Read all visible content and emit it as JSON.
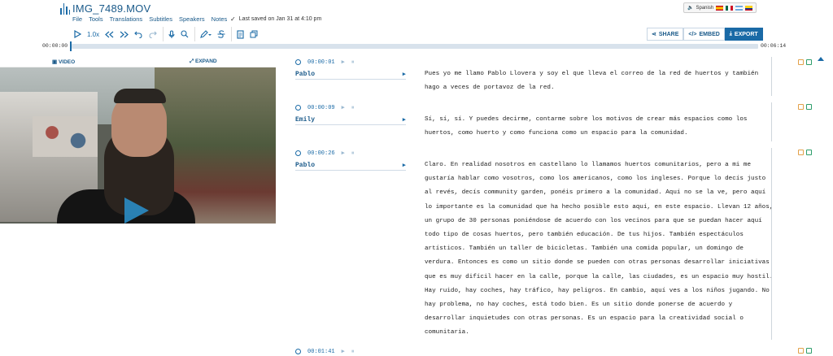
{
  "header": {
    "file_title": "IMG_7489.MOV",
    "menu": [
      "File",
      "Tools",
      "Translations",
      "Subtitles",
      "Speakers",
      "Notes"
    ],
    "saved_status": "Last saved on Jan 31 at 4:10 pm",
    "language_label": "Spanish"
  },
  "toolbar": {
    "speed": "1.0x",
    "share_label": "SHARE",
    "embed_label": "EMBED",
    "export_label": "EXPORT"
  },
  "timeline": {
    "current_time": "00:00:00",
    "total_time": "00:06:14",
    "progress": 0
  },
  "video_panel": {
    "video_label": "VIDEO",
    "expand_label": "EXPAND"
  },
  "transcript": {
    "segments": [
      {
        "timestamp": "00:00:01",
        "speaker": "Pablo",
        "text": "Pues yo me llamo Pablo Llovera y soy el que lleva el correo de la red de huertos y también hago a veces de portavoz de la red."
      },
      {
        "timestamp": "00:00:09",
        "speaker": "Emily",
        "text": "Sí, sí, sí. Y puedes decirme, contarme sobre los motivos de crear más espacios como los huertos, como huerto y como funciona como un espacio para la comunidad."
      },
      {
        "timestamp": "00:00:26",
        "speaker": "Pablo",
        "text": "Claro. En realidad nosotros en castellano lo llamamos huertos comunitarios, pero a mi me gustaría hablar como vosotros, como los americanos, como los ingleses. Porque lo decís justo al revés, decís community garden, ponéis primero a la comunidad. Aquí no se la ve, pero aquí lo importante es la comunidad que ha hecho posible esto aquí, en este espacio. Llevan 12 años, un grupo de 30 personas poniéndose de acuerdo con los vecinos para que se puedan hacer aquí todo tipo de cosas huertos, pero también educación. De tus hijos. También espectáculos artísticos. También un taller de bicicletas. También una comida popular, un domingo de verdura. Entonces es como un sitio donde se pueden con otras personas desarrollar iniciativas que es muy difícil hacer en la calle, porque la calle, las ciudades, es un espacio muy hostil. Hay ruido, hay coches, hay tráfico, hay peligros. En cambio, aquí ves a los niños jugando. No hay problema, no hay coches, está todo bien. Es un sitio donde ponerse de acuerdo y desarrollar inquietudes con otras personas. Es un espacio para la creatividad social o comunitaria."
      },
      {
        "timestamp": "00:01:41",
        "speaker": "",
        "text": ""
      }
    ]
  },
  "colors": {
    "accent": "#1a6aa6",
    "note_orange": "#e2a14a",
    "note_green": "#2e9e6b"
  }
}
